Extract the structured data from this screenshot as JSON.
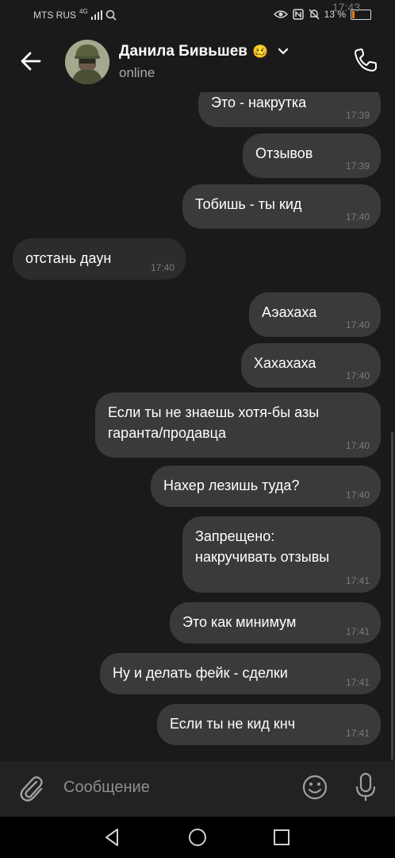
{
  "status_bar": {
    "carrier": "MTS RUS",
    "network": "4G",
    "battery": "13 %",
    "battery_level": 0.13,
    "time": "17:43"
  },
  "header": {
    "contact_name": "Данила Бивьшев",
    "emoji": "🥴",
    "status": "online"
  },
  "messages": [
    {
      "dir": "out",
      "text": "Это - накрутка",
      "time": "17:39"
    },
    {
      "dir": "out",
      "text": "Отзывов",
      "time": "17:39"
    },
    {
      "dir": "out",
      "text": "Тобишь - ты кид",
      "time": "17:40"
    },
    {
      "dir": "in",
      "text": "отстань даун",
      "time": "17:40"
    },
    {
      "dir": "out",
      "text": "Аэахаха",
      "time": "17:40"
    },
    {
      "dir": "out",
      "text": "Хахахаха",
      "time": "17:40"
    },
    {
      "dir": "out",
      "line1": "Если ты не знаешь хотя-бы азы",
      "line2": "гаранта/продавца",
      "time": "17:40"
    },
    {
      "dir": "out",
      "text": "Нахер лезишь туда?",
      "time": "17:40"
    },
    {
      "dir": "out",
      "line1": "Запрещено:",
      "line2": "накручивать отзывы",
      "time": "17:41"
    },
    {
      "dir": "out",
      "text": "Это как минимум",
      "time": "17:41"
    },
    {
      "dir": "out",
      "text": "Ну и делать фейк - сделки",
      "time": "17:41"
    },
    {
      "dir": "out",
      "text": "Если ты не кид кнч",
      "time": "17:41"
    }
  ],
  "composer": {
    "placeholder": "Сообщение"
  },
  "icons": {
    "back": "arrow-left-icon",
    "call": "phone-icon",
    "attach": "paperclip-icon",
    "emoji": "smile-icon",
    "mic": "microphone-icon"
  },
  "colors": {
    "background": "#1a1a1a",
    "bubble": "#3a3a3c",
    "accent_battery": "#f07d1a"
  }
}
